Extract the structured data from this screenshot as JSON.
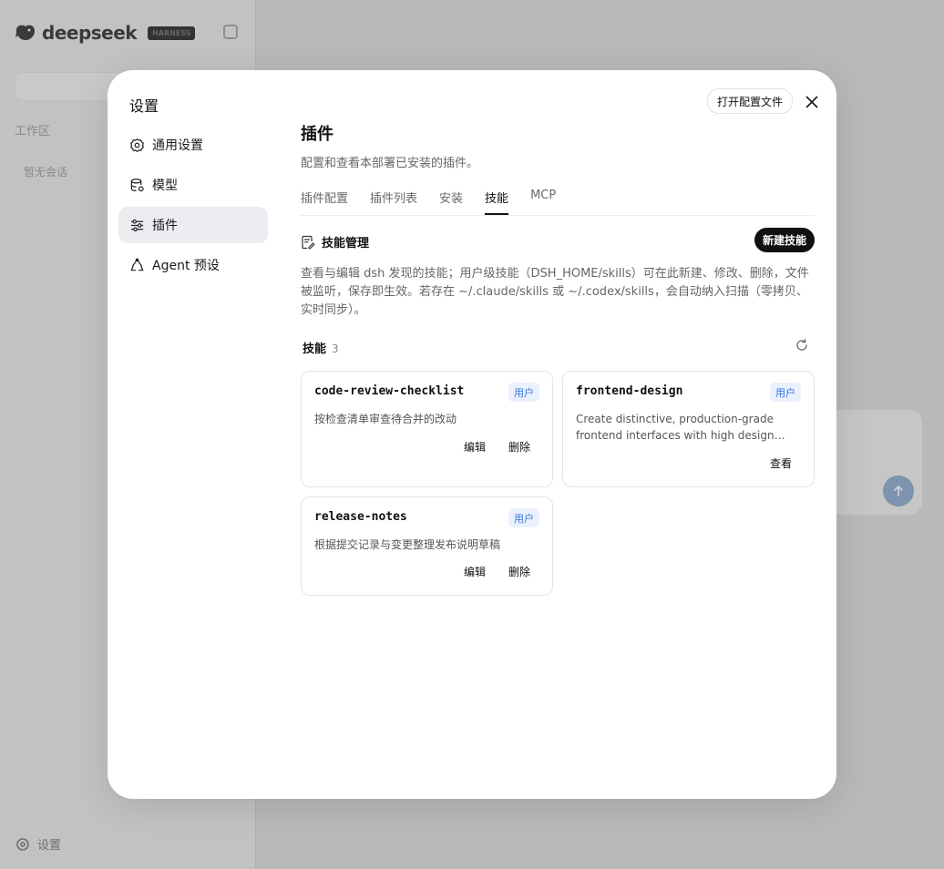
{
  "app": {
    "brand": "deepseek",
    "brand_badge": "HARNESS",
    "workspace_label": "工作区",
    "no_session_label": "暂无会话",
    "settings_label": "设置"
  },
  "modal": {
    "title": "设置",
    "nav": [
      {
        "label": "通用设置",
        "icon": "gear-icon"
      },
      {
        "label": "模型",
        "icon": "database-icon"
      },
      {
        "label": "插件",
        "icon": "sliders-icon",
        "active": true
      },
      {
        "label": "Agent 预设",
        "icon": "agent-icon"
      }
    ],
    "open_config_label": "打开配置文件",
    "section_title": "插件",
    "section_desc": "配置和查看本部署已安装的插件。",
    "tabs": [
      "插件配置",
      "插件列表",
      "安装",
      "技能",
      "MCP"
    ],
    "active_tab": "技能",
    "mgmt_title": "技能管理",
    "new_skill_label": "新建技能",
    "mgmt_desc": "查看与编辑 dsh 发现的技能；用户级技能（DSH_HOME/skills）可在此新建、修改、删除，文件被监听，保存即生效。若存在 ~/.claude/skills 或 ~/.codex/skills，会自动纳入扫描（零拷贝、实时同步）。",
    "skills_label": "技能",
    "skills_count": "3",
    "skills": [
      {
        "name": "code-review-checklist",
        "badge": "用户",
        "desc": "按检查清单审查待合并的改动",
        "actions": [
          "编辑",
          "删除"
        ]
      },
      {
        "name": "frontend-design",
        "badge": "用户",
        "desc": "Create distinctive, production-grade frontend interfaces with high design quality. Use this skill when the user asks to build web components, pages, or applications.",
        "actions": [
          "查看"
        ]
      },
      {
        "name": "release-notes",
        "badge": "用户",
        "desc": "根据提交记录与变更整理发布说明草稿",
        "actions": [
          "编辑",
          "删除"
        ]
      }
    ]
  },
  "colors": {
    "accent": "#111111",
    "badge_bg": "#eaf1fd",
    "badge_text": "#3a73d8",
    "active_nav_bg": "#ebedf1"
  }
}
